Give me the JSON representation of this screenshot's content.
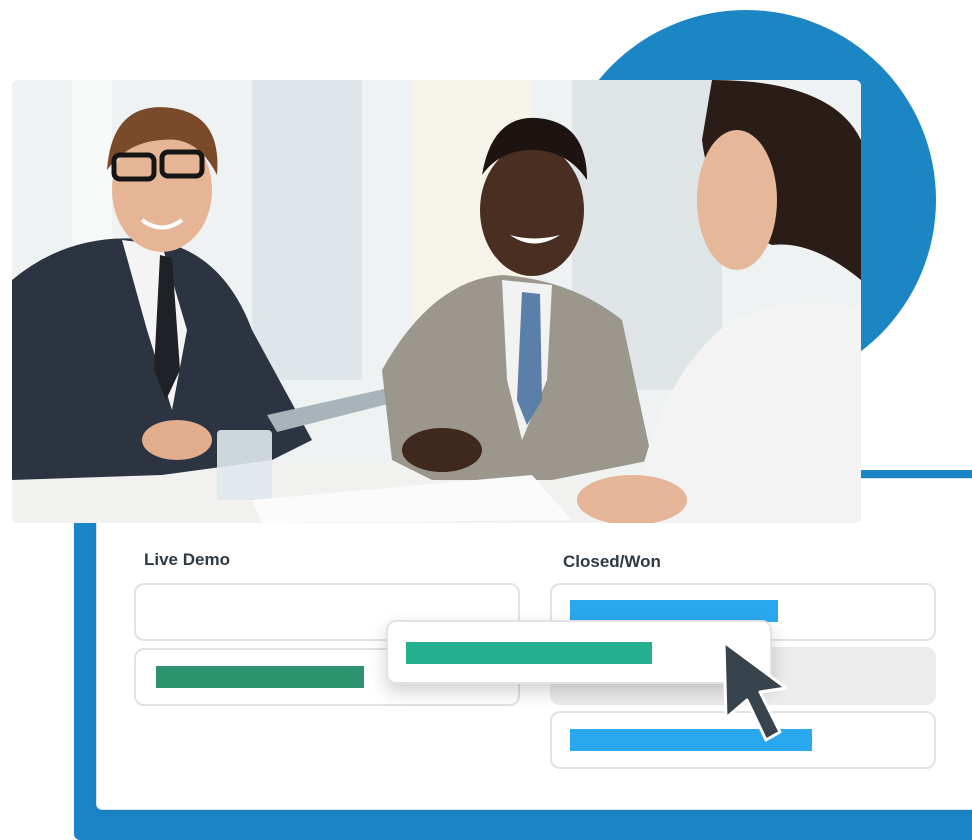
{
  "board": {
    "columns": [
      {
        "title": "Live Demo"
      },
      {
        "title": "Closed/Won"
      }
    ]
  },
  "colors": {
    "accent_blue": "#1c86c4",
    "bar_blue": "#2aa8ee",
    "bar_green": "#2e9470",
    "bar_teal": "#22b08e",
    "cursor": "#37434d"
  },
  "icons": {
    "cursor": "mouse-pointer-icon"
  }
}
